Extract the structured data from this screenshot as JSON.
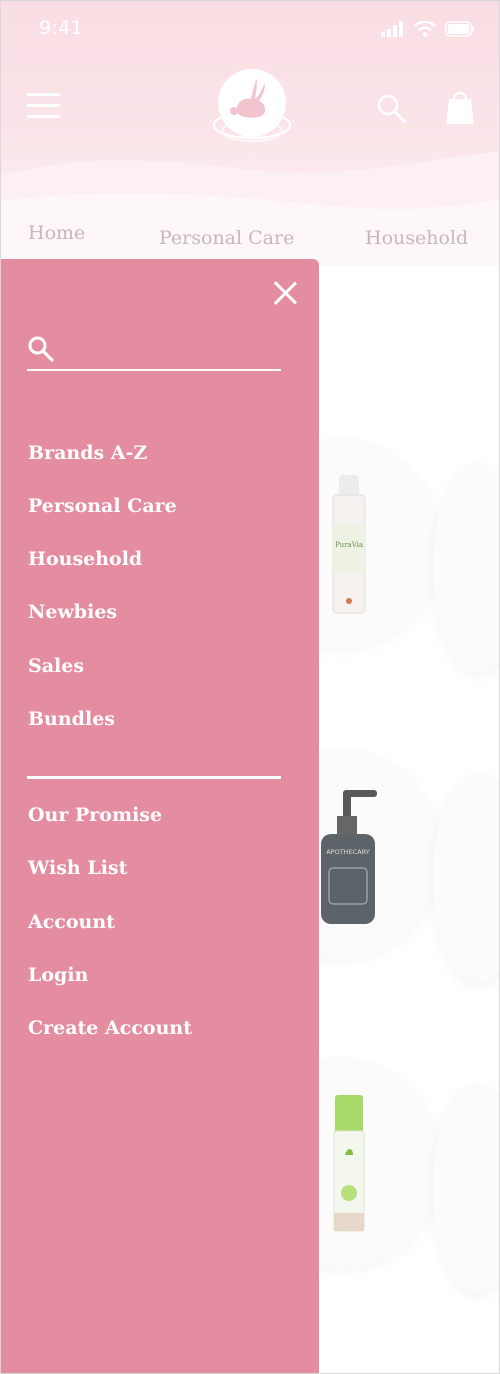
{
  "status_bar": {
    "time": "9:41"
  },
  "header": {
    "menu_icon": "hamburger-icon",
    "logo_icon": "rabbit-logo-icon",
    "search_icon": "search-icon",
    "cart_icon": "shopping-bag-icon"
  },
  "category_nav": [
    "Home",
    "Personal Care",
    "Household"
  ],
  "drawer": {
    "search": {
      "placeholder": "",
      "value": ""
    },
    "primary_items": [
      "Brands A-Z",
      "Personal Care",
      "Household",
      "Newbies",
      "Sales",
      "Bundles"
    ],
    "secondary_items": [
      "Our Promise",
      "Wish List",
      "Account",
      "Login",
      "Create Account"
    ],
    "colors": {
      "background": "#e48da0",
      "text": "#ffffff"
    }
  },
  "products": [
    {
      "image": "spray-bottle",
      "brand_text": "PuraVia"
    },
    {
      "image": "pump-bottle",
      "brand_text": "APOTHECARY"
    },
    {
      "image": "green-cap-bottle"
    }
  ]
}
